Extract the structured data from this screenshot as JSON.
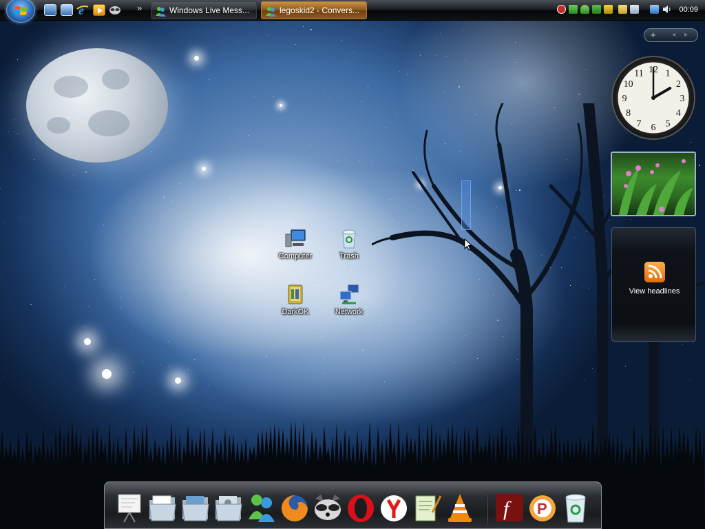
{
  "taskbar": {
    "start_button": "start-orb",
    "quick_launch": [
      {
        "name": "show-desktop-icon"
      },
      {
        "name": "switch-windows-icon"
      },
      {
        "name": "internet-explorer-icon"
      },
      {
        "name": "media-player-icon"
      },
      {
        "name": "raccoon-app-icon"
      }
    ],
    "windows": [
      {
        "label": "Windows Live Mess...",
        "icon": "messenger-icon",
        "active": false
      },
      {
        "label": "legoskid2 - Convers...",
        "icon": "messenger-icon",
        "active": true
      }
    ],
    "tray_icons": [
      "shield-alert-icon",
      "network-tray-icon",
      "messenger-tray-icon",
      "user-tray-icon",
      "security-lock-icon",
      "folder-tray-icon",
      "window-tray-icon",
      "network-status-icon",
      "volume-icon"
    ],
    "clock": "00:09"
  },
  "desktop": {
    "icons": [
      {
        "label": "Computer",
        "icon": "computer-icon"
      },
      {
        "label": "Trash",
        "icon": "recycle-bin-icon"
      },
      {
        "label": "DarkOK",
        "icon": "folder-icon"
      },
      {
        "label": "Network",
        "icon": "network-icon"
      }
    ]
  },
  "sidebar": {
    "controls": [
      "+",
      "◂",
      "▸"
    ],
    "clock_gadget": {
      "hour_numerals": [
        "12",
        "1",
        "2",
        "3",
        "4",
        "5",
        "6",
        "7",
        "8",
        "9",
        "10",
        "11"
      ],
      "time": "2:00"
    },
    "feed_gadget": {
      "link": "View headlines"
    }
  },
  "dock": {
    "items": [
      "presentation-icon",
      "file-manager-icon",
      "photos-folder-icon",
      "control-folder-icon",
      "messenger-icon",
      "firefox-icon",
      "raccoon-app-icon",
      "opera-icon",
      "yandex-icon",
      "notepad-icon",
      "vlc-icon",
      "flash-icon",
      "pidgin-icon",
      "recycle-bin-icon"
    ]
  },
  "colors": {
    "taskbar": "#0b0d10",
    "active_task": "#b07a2c",
    "accent": "#2b6cb8",
    "rss": "#f08a1c"
  }
}
